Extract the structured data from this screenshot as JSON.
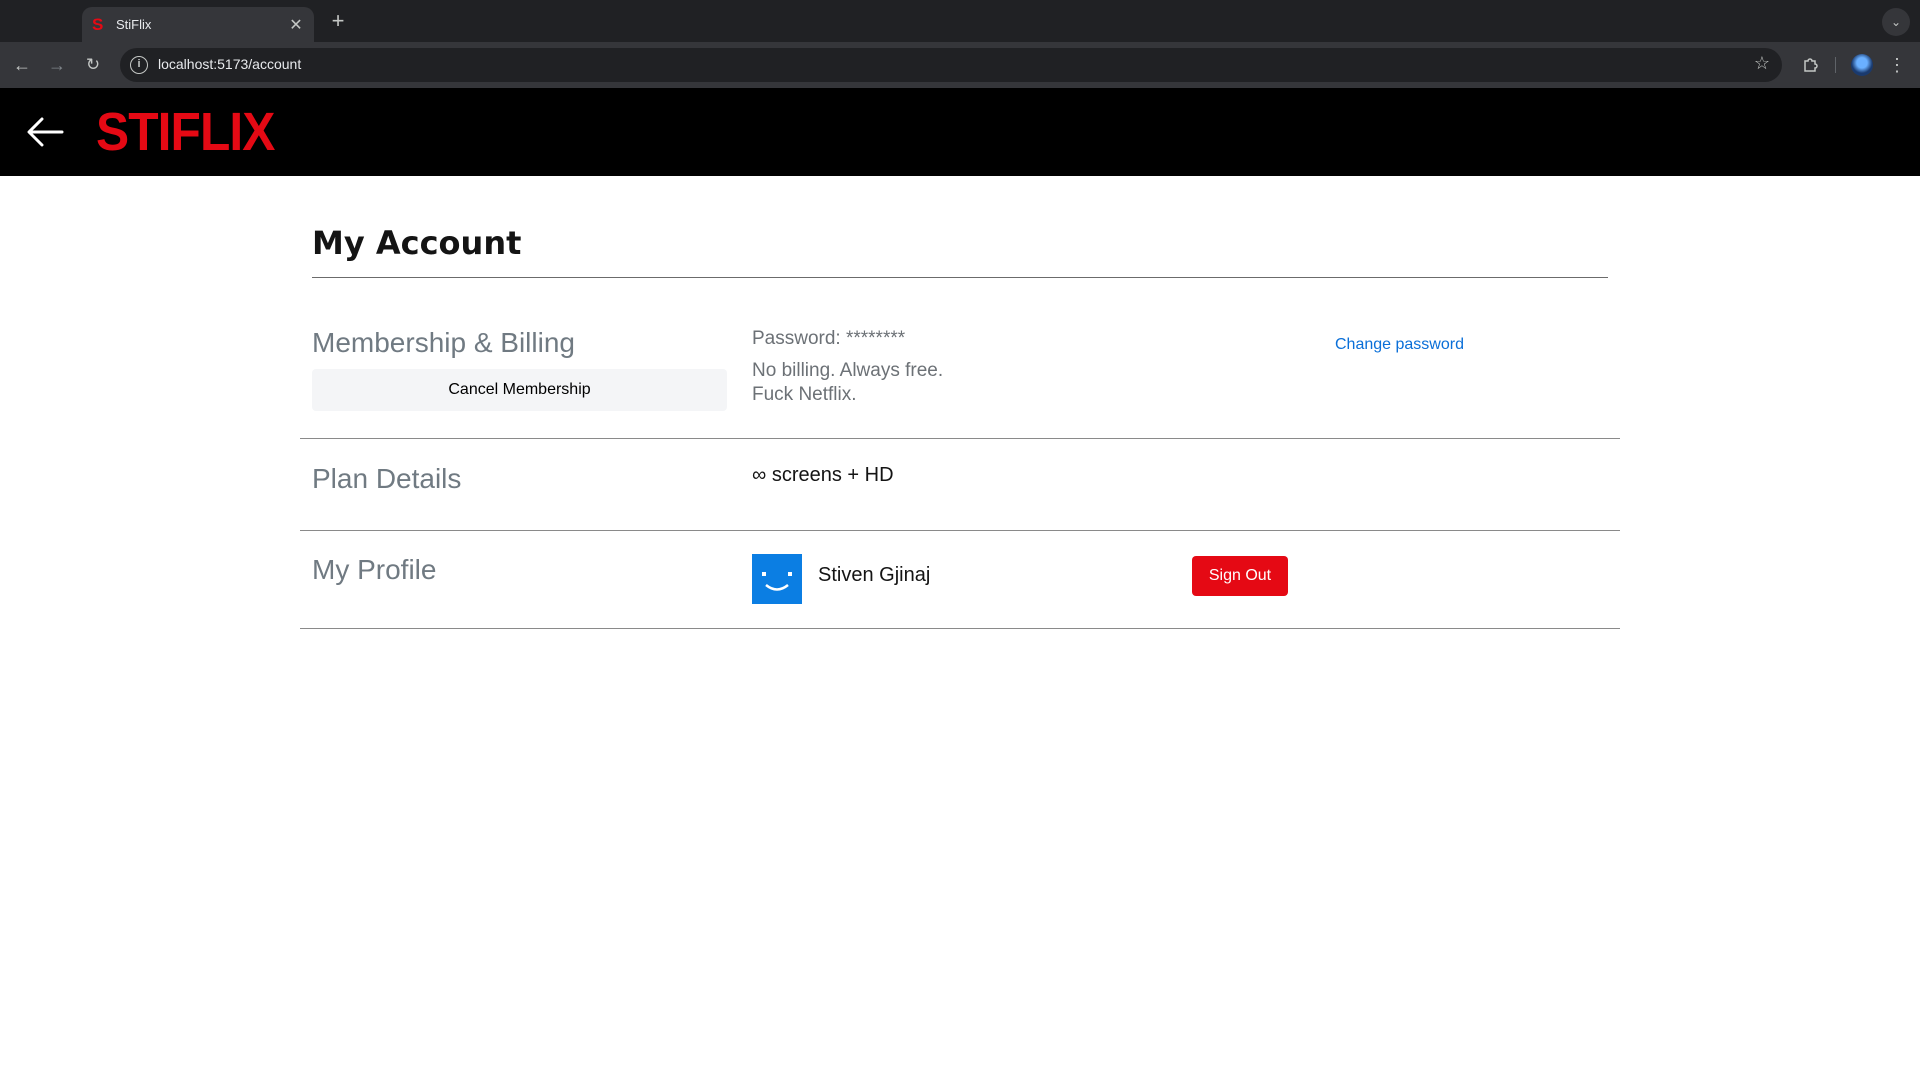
{
  "browser": {
    "tab_title": "StiFlix",
    "tab_favicon": "S",
    "tab_close": "✕",
    "new_tab": "+",
    "url": "localhost:5173/account",
    "back_icon": "←",
    "forward_icon": "→",
    "reload_icon": "↻",
    "star_icon": "☆",
    "menu_icon": "⋮"
  },
  "app": {
    "logo": "STIFLIX",
    "brand_color": "#e50914"
  },
  "page": {
    "title": "My Account"
  },
  "membership": {
    "heading": "Membership & Billing",
    "cancel_label": "Cancel Membership",
    "password_line": "Password: ********",
    "billing_line": "No billing. Always free.",
    "extra_line": "Fuck Netflix.",
    "change_password_label": "Change password"
  },
  "plan": {
    "heading": "Plan Details",
    "details": "∞ screens + HD"
  },
  "profile": {
    "heading": "My Profile",
    "name": "Stiven Gjinaj",
    "signout_label": "Sign Out"
  }
}
